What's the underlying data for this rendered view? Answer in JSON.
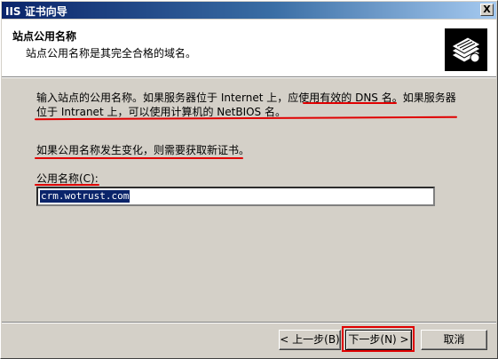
{
  "window": {
    "title": "IIS 证书向导",
    "close_label": "X"
  },
  "header": {
    "title": "站点公用名称",
    "subtitle": "站点公用名称是其完全合格的域名。",
    "icon": "certificate-stack-icon"
  },
  "body": {
    "para1_line1": "输入站点的公用名称。如果服务器位于 Internet 上，应使用有效的 DNS 名。如果服务器",
    "para1_line2": "位于 Intranet 上，可以使用计算机的 NetBIOS 名。",
    "para2": "如果公用名称发生变化，则需要获取新证书。",
    "field_label": "公用名称(C):",
    "field_value": "crm.wotrust.com"
  },
  "buttons": {
    "back": "< 上一步(B)",
    "next": "下一步(N) >",
    "cancel": "取消"
  },
  "colors": {
    "highlight": "#e00000",
    "titlebar": "#0a246a"
  }
}
